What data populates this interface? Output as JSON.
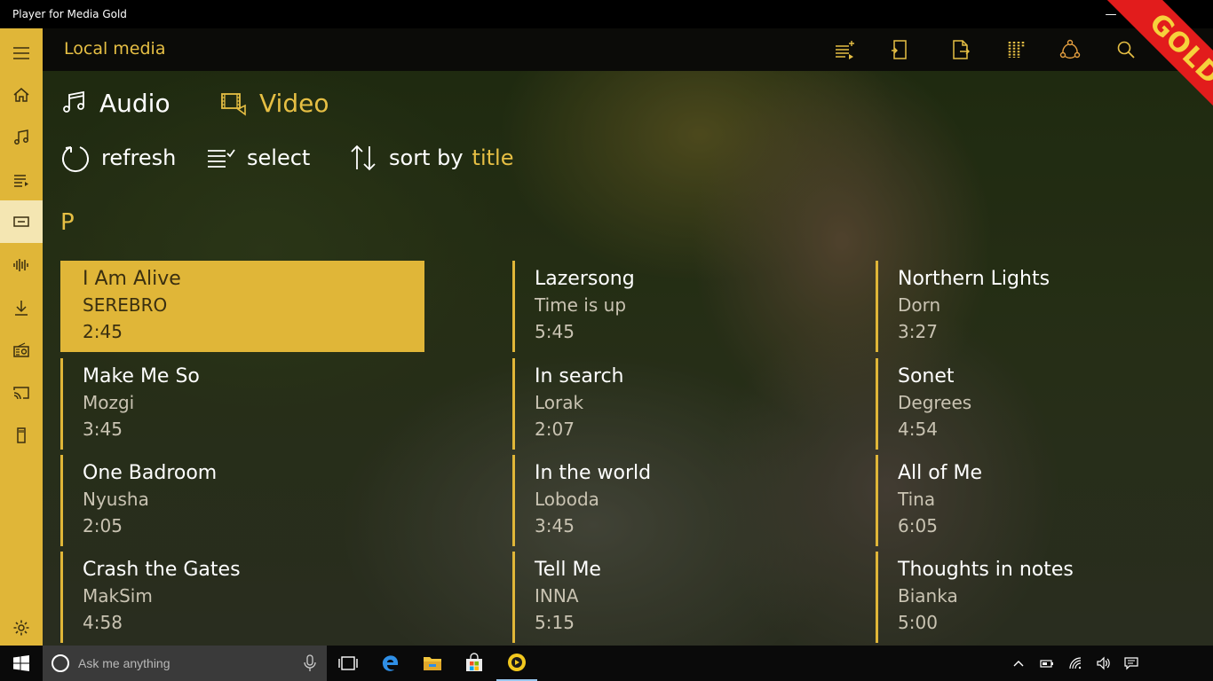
{
  "window": {
    "title": "Player for Media Gold",
    "minimize_glyph": "—",
    "ribbon_text": "GOLD"
  },
  "sidebar": {
    "items": [
      {
        "icon": "hamburger-icon"
      },
      {
        "icon": "home-icon"
      },
      {
        "icon": "music-icon"
      },
      {
        "icon": "playlist-icon"
      },
      {
        "icon": "local-media-icon",
        "active": true
      },
      {
        "icon": "equalizer-icon"
      },
      {
        "icon": "download-icon"
      },
      {
        "icon": "radio-icon"
      },
      {
        "icon": "cast-icon"
      },
      {
        "icon": "sd-card-icon"
      },
      {
        "icon": "settings-icon"
      }
    ]
  },
  "header": {
    "title": "Local media",
    "actions": [
      "add-to-playlist-icon",
      "open-folder-icon",
      "open-file-icon",
      "library-icon",
      "share-icon",
      "search-icon"
    ]
  },
  "pivot": {
    "audio_label": "Audio",
    "video_label": "Video",
    "selected": "Audio"
  },
  "commands": {
    "refresh_label": "refresh",
    "select_label": "select",
    "sort_label": "sort by",
    "sort_value": "title"
  },
  "group": {
    "letter": "P",
    "tracks": [
      {
        "title": "I Am Alive",
        "artist": "SEREBRO",
        "duration": "2:45",
        "selected": true
      },
      {
        "title": "Lazersong",
        "artist": "Time is up",
        "duration": "5:45"
      },
      {
        "title": "Northern Lights",
        "artist": "Dorn",
        "duration": "3:27"
      },
      {
        "title": "Make Me So",
        "artist": "Mozgi",
        "duration": "3:45"
      },
      {
        "title": "In search",
        "artist": "Lorak",
        "duration": "2:07"
      },
      {
        "title": "Sonet",
        "artist": "Degrees",
        "duration": "4:54"
      },
      {
        "title": "One Badroom",
        "artist": "Nyusha",
        "duration": "2:05"
      },
      {
        "title": "In the world",
        "artist": "Loboda",
        "duration": "3:45"
      },
      {
        "title": "All of Me",
        "artist": "Tina",
        "duration": "6:05"
      },
      {
        "title": "Crash the Gates",
        "artist": "MakSim",
        "duration": "4:58"
      },
      {
        "title": "Tell Me",
        "artist": "INNA",
        "duration": "5:15"
      },
      {
        "title": "Thoughts in notes",
        "artist": "Bianka",
        "duration": "5:00"
      }
    ]
  },
  "taskbar": {
    "search_placeholder": "Ask me anything",
    "apps": [
      "task-view-icon",
      "edge-icon",
      "file-explorer-icon",
      "store-icon",
      "player-gold-icon"
    ],
    "tray": [
      "chevron-up-icon",
      "battery-icon",
      "wifi-icon",
      "volume-icon",
      "action-center-icon"
    ]
  },
  "colors": {
    "accent": "#e0b638",
    "accent_text": "#e6bf44"
  }
}
